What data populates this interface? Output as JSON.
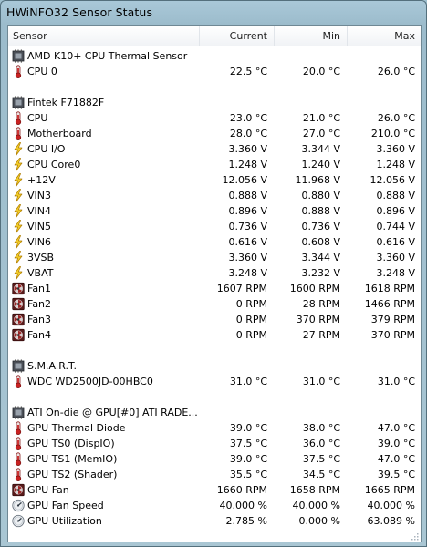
{
  "window": {
    "title": "HWiNFO32 Sensor Status"
  },
  "columns": {
    "sensor": "Sensor",
    "current": "Current",
    "min": "Min",
    "max": "Max"
  },
  "rows": [
    {
      "kind": "group",
      "icon": "chip-icon",
      "name": "AMD K10+ CPU Thermal Sensor"
    },
    {
      "kind": "sensor",
      "icon": "thermometer-icon",
      "name": "CPU 0",
      "current": "22.5 °C",
      "min": "20.0 °C",
      "max": "26.0 °C"
    },
    {
      "kind": "blank"
    },
    {
      "kind": "group",
      "icon": "chip-icon",
      "name": "Fintek F71882F"
    },
    {
      "kind": "sensor",
      "icon": "thermometer-icon",
      "name": "CPU",
      "current": "23.0 °C",
      "min": "21.0 °C",
      "max": "26.0 °C"
    },
    {
      "kind": "sensor",
      "icon": "thermometer-icon",
      "name": "Motherboard",
      "current": "28.0 °C",
      "min": "27.0 °C",
      "max": "210.0 °C"
    },
    {
      "kind": "sensor",
      "icon": "lightning-icon",
      "name": "CPU I/O",
      "current": "3.360 V",
      "min": "3.344 V",
      "max": "3.360 V"
    },
    {
      "kind": "sensor",
      "icon": "lightning-icon",
      "name": "CPU Core0",
      "current": "1.248 V",
      "min": "1.240 V",
      "max": "1.248 V"
    },
    {
      "kind": "sensor",
      "icon": "lightning-icon",
      "name": "+12V",
      "current": "12.056 V",
      "min": "11.968 V",
      "max": "12.056 V"
    },
    {
      "kind": "sensor",
      "icon": "lightning-icon",
      "name": "VIN3",
      "current": "0.888 V",
      "min": "0.880 V",
      "max": "0.888 V"
    },
    {
      "kind": "sensor",
      "icon": "lightning-icon",
      "name": "VIN4",
      "current": "0.896 V",
      "min": "0.888 V",
      "max": "0.896 V"
    },
    {
      "kind": "sensor",
      "icon": "lightning-icon",
      "name": "VIN5",
      "current": "0.736 V",
      "min": "0.736 V",
      "max": "0.744 V"
    },
    {
      "kind": "sensor",
      "icon": "lightning-icon",
      "name": "VIN6",
      "current": "0.616 V",
      "min": "0.608 V",
      "max": "0.616 V"
    },
    {
      "kind": "sensor",
      "icon": "lightning-icon",
      "name": "3VSB",
      "current": "3.360 V",
      "min": "3.344 V",
      "max": "3.360 V"
    },
    {
      "kind": "sensor",
      "icon": "lightning-icon",
      "name": "VBAT",
      "current": "3.248 V",
      "min": "3.232 V",
      "max": "3.248 V"
    },
    {
      "kind": "sensor",
      "icon": "fan-icon",
      "name": "Fan1",
      "current": "1607 RPM",
      "min": "1600 RPM",
      "max": "1618 RPM"
    },
    {
      "kind": "sensor",
      "icon": "fan-icon",
      "name": "Fan2",
      "current": "0 RPM",
      "min": "28 RPM",
      "max": "1466 RPM"
    },
    {
      "kind": "sensor",
      "icon": "fan-icon",
      "name": "Fan3",
      "current": "0 RPM",
      "min": "370 RPM",
      "max": "379 RPM"
    },
    {
      "kind": "sensor",
      "icon": "fan-icon",
      "name": "Fan4",
      "current": "0 RPM",
      "min": "27 RPM",
      "max": "370 RPM"
    },
    {
      "kind": "blank"
    },
    {
      "kind": "group",
      "icon": "chip-icon",
      "name": "S.M.A.R.T."
    },
    {
      "kind": "sensor",
      "icon": "thermometer-icon",
      "name": "WDC WD2500JD-00HBC0",
      "current": "31.0 °C",
      "min": "31.0 °C",
      "max": "31.0 °C"
    },
    {
      "kind": "blank"
    },
    {
      "kind": "group",
      "icon": "chip-icon",
      "name": "ATI On-die @ GPU[#0] ATI RADE..."
    },
    {
      "kind": "sensor",
      "icon": "thermometer-icon",
      "name": "GPU Thermal Diode",
      "current": "39.0 °C",
      "min": "38.0 °C",
      "max": "47.0 °C"
    },
    {
      "kind": "sensor",
      "icon": "thermometer-icon",
      "name": "GPU TS0 (DispIO)",
      "current": "37.5 °C",
      "min": "36.0 °C",
      "max": "39.0 °C"
    },
    {
      "kind": "sensor",
      "icon": "thermometer-icon",
      "name": "GPU TS1 (MemIO)",
      "current": "39.0 °C",
      "min": "37.5 °C",
      "max": "47.0 °C"
    },
    {
      "kind": "sensor",
      "icon": "thermometer-icon",
      "name": "GPU TS2 (Shader)",
      "current": "35.5 °C",
      "min": "34.5 °C",
      "max": "39.5 °C"
    },
    {
      "kind": "sensor",
      "icon": "fan-icon",
      "name": "GPU Fan",
      "current": "1660 RPM",
      "min": "1658 RPM",
      "max": "1665 RPM"
    },
    {
      "kind": "sensor",
      "icon": "gauge-icon",
      "name": "GPU Fan Speed",
      "current": "40.000 %",
      "min": "40.000 %",
      "max": "40.000 %"
    },
    {
      "kind": "sensor",
      "icon": "gauge-icon",
      "name": "GPU Utilization",
      "current": "2.785 %",
      "min": "0.000 %",
      "max": "63.089 %"
    }
  ]
}
